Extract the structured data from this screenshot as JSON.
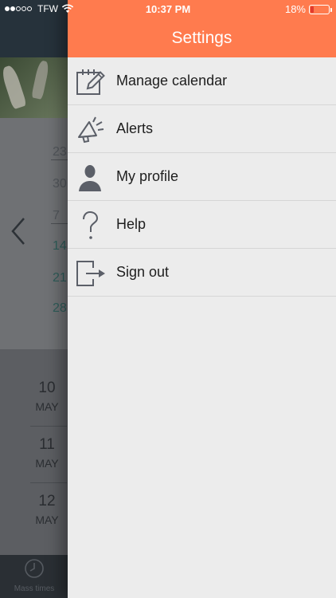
{
  "status_bar": {
    "carrier": "TFW",
    "time": "10:37 PM",
    "battery_percent": "18%",
    "battery_level": 0.18,
    "battery_color": "#e03a2f"
  },
  "drawer": {
    "title": "Settings",
    "header_color": "#ff7b4e",
    "items": [
      {
        "label": "Manage calendar",
        "icon": "calendar-edit-icon"
      },
      {
        "label": "Alerts",
        "icon": "megaphone-icon"
      },
      {
        "label": "My profile",
        "icon": "person-icon"
      },
      {
        "label": "Help",
        "icon": "question-mark-icon"
      },
      {
        "label": "Sign out",
        "icon": "sign-out-icon"
      }
    ]
  },
  "background": {
    "calendar_days": [
      "23",
      "30",
      "7",
      "14",
      "21",
      "28"
    ],
    "dates": [
      {
        "day": "10",
        "month": "MAY"
      },
      {
        "day": "11",
        "month": "MAY"
      },
      {
        "day": "12",
        "month": "MAY"
      }
    ],
    "tab_label": "Mass times"
  }
}
